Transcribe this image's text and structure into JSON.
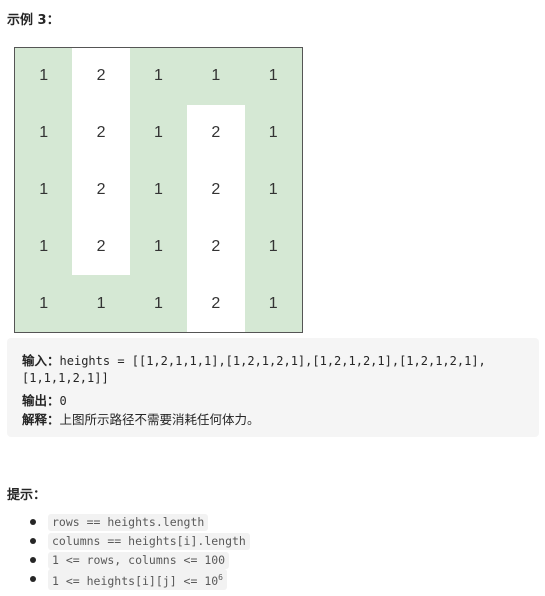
{
  "example_heading": "示例 3：",
  "grid": [
    [
      "1",
      "2",
      "1",
      "1",
      "1"
    ],
    [
      "1",
      "2",
      "1",
      "2",
      "1"
    ],
    [
      "1",
      "2",
      "1",
      "2",
      "1"
    ],
    [
      "1",
      "2",
      "1",
      "2",
      "1"
    ],
    [
      "1",
      "1",
      "1",
      "2",
      "1"
    ]
  ],
  "path_cells": [
    [
      true,
      false,
      true,
      true,
      true
    ],
    [
      true,
      false,
      true,
      false,
      true
    ],
    [
      true,
      false,
      true,
      false,
      true
    ],
    [
      true,
      false,
      true,
      false,
      true
    ],
    [
      true,
      true,
      true,
      false,
      true
    ]
  ],
  "colors": {
    "path": "#d5e8d4",
    "other": "#ffffff"
  },
  "example": {
    "input_label": "输入：",
    "input_value_line1": "heights = [[1,2,1,1,1],[1,2,1,2,1],[1,2,1,2,1],[1,2,1,2,1],",
    "input_value_line2": "[1,1,1,2,1]]",
    "output_label": "输出：",
    "output_value": "0",
    "explanation_label": "解释：",
    "explanation_value": "上图所示路径不需要消耗任何体力。"
  },
  "hints_heading": "提示：",
  "hints": [
    "rows == heights.length",
    "columns == heights[i].length",
    "1 <= rows, columns <= 100",
    "1 <= heights[i][j] <= 10"
  ],
  "hint_exponent": "6"
}
